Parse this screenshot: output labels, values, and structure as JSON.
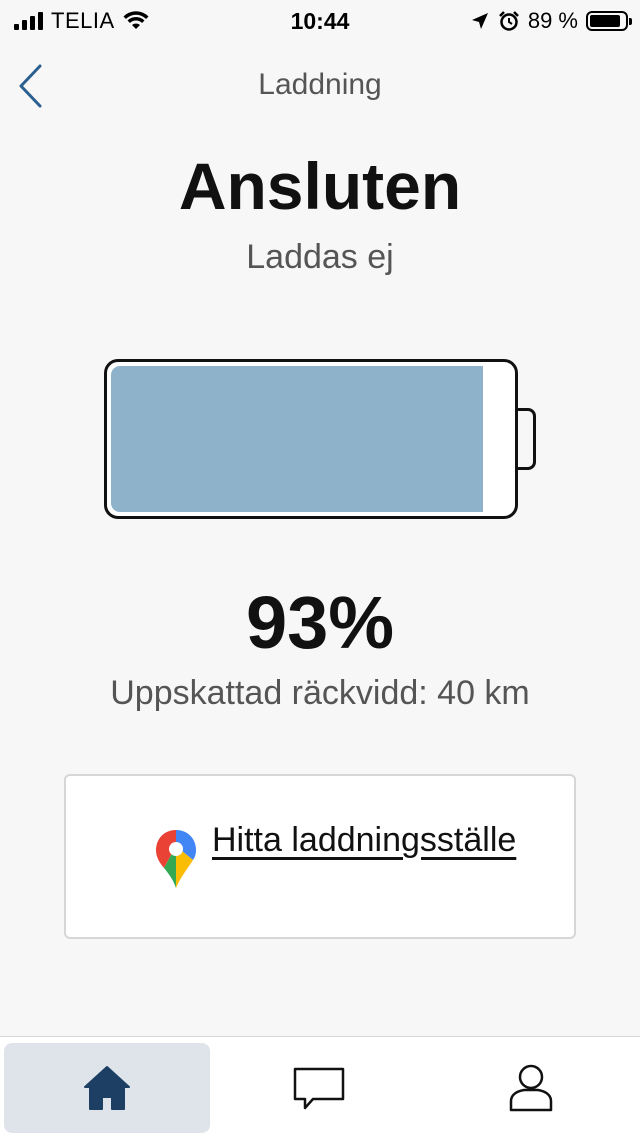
{
  "status_bar": {
    "carrier": "TELIA",
    "time": "10:44",
    "battery_text": "89 %",
    "battery_level_fraction": 0.89
  },
  "header": {
    "back_icon": "chevron-left-icon",
    "title": "Laddning"
  },
  "status": {
    "headline": "Ansluten",
    "subline": "Laddas ej"
  },
  "battery": {
    "level_fraction": 0.93,
    "fill_color": "#8fb2cb",
    "percent_text": "93%",
    "range_text": "Uppskattad räckvidd: 40 km"
  },
  "find_charging": {
    "icon": "google-maps-pin-icon",
    "label": "Hitta laddningsställe"
  },
  "tabbar": {
    "tabs": [
      {
        "icon": "home-icon",
        "active": true
      },
      {
        "icon": "chat-icon",
        "active": false
      },
      {
        "icon": "user-icon",
        "active": false
      }
    ],
    "active_color": "#1c3f63"
  }
}
